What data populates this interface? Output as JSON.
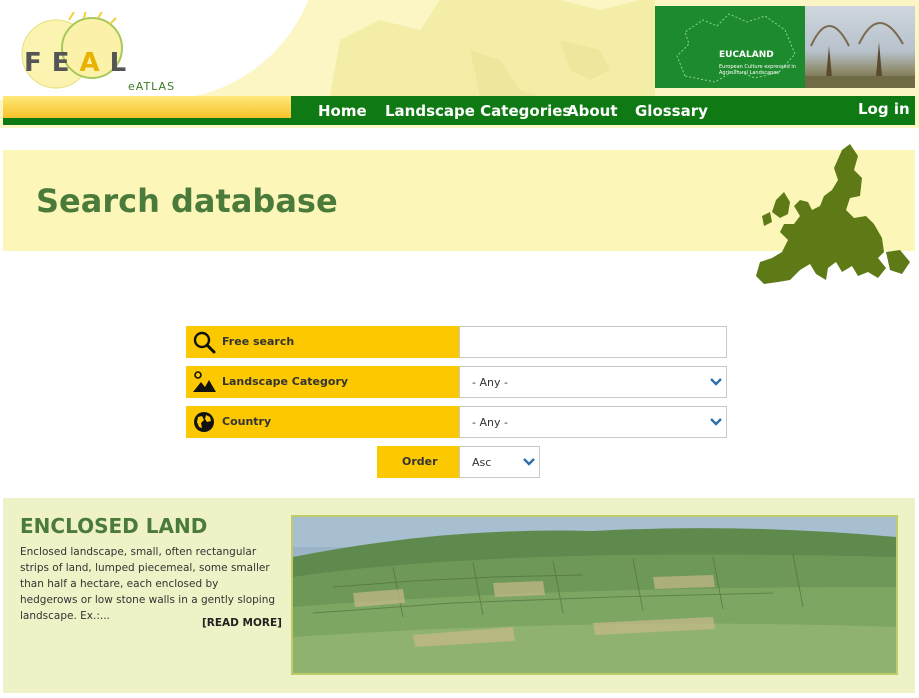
{
  "logo": {
    "letters": [
      "F",
      "E",
      "A",
      "L"
    ],
    "sub": "eATLAS"
  },
  "banner": {
    "title": "EUCALAND",
    "subtitle": "European Culture expressed in Agricultural Landscapes"
  },
  "nav": {
    "items": [
      "Home",
      "Landscape Categories",
      "About",
      "Glossary"
    ],
    "login": "Log in"
  },
  "page": {
    "title": "Search database"
  },
  "search": {
    "free_label": "Free search",
    "free_value": "",
    "category_label": "Landscape Category",
    "category_value": "- Any -",
    "country_label": "Country",
    "country_value": "- Any -",
    "order_label": "Order",
    "order_value": "Asc"
  },
  "icons": {
    "search": "magnifier-icon",
    "category": "landscape-icon",
    "country": "globe-icon",
    "dropdown": "chevron-down-icon"
  },
  "colors": {
    "nav_green": "#0f7a14",
    "label_yellow": "#fcc800",
    "title_green": "#4a7b3b",
    "band_yellow": "#fcf7b8",
    "card_bg": "#eff2c6"
  },
  "result": {
    "title": "ENCLOSED LAND",
    "description": "Enclosed landscape, small, often rectangular strips of land, lumped piecemeal, some smaller than half a hectare, each enclosed by hedgerows or low stone walls in a gently sloping landscape. Ex.:...",
    "read_more": "[READ MORE]"
  }
}
